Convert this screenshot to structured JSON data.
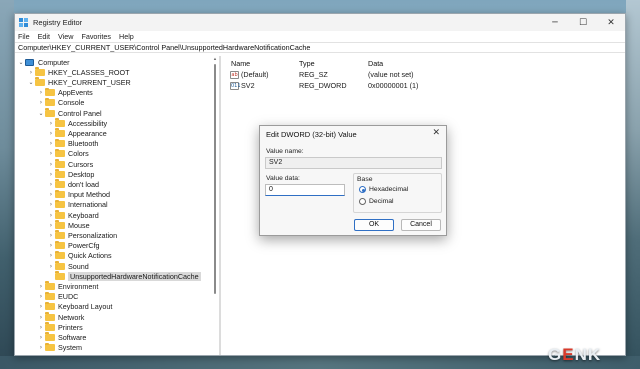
{
  "window": {
    "title": "Registry Editor",
    "controls": [
      "─",
      "☐",
      "✕"
    ]
  },
  "menu": [
    "File",
    "Edit",
    "View",
    "Favorites",
    "Help"
  ],
  "address": "Computer\\HKEY_CURRENT_USER\\Control Panel\\UnsupportedHardwareNotificationCache",
  "tree": {
    "root": "Computer",
    "items": [
      {
        "label": "HKEY_CLASSES_ROOT",
        "depth": 1,
        "expanded": false
      },
      {
        "label": "HKEY_CURRENT_USER",
        "depth": 1,
        "expanded": true
      },
      {
        "label": "AppEvents",
        "depth": 2,
        "expanded": false
      },
      {
        "label": "Console",
        "depth": 2,
        "expanded": false
      },
      {
        "label": "Control Panel",
        "depth": 2,
        "expanded": true
      },
      {
        "label": "Accessibility",
        "depth": 3,
        "expanded": false
      },
      {
        "label": "Appearance",
        "depth": 3,
        "expanded": false
      },
      {
        "label": "Bluetooth",
        "depth": 3,
        "expanded": false
      },
      {
        "label": "Colors",
        "depth": 3,
        "expanded": false
      },
      {
        "label": "Cursors",
        "depth": 3,
        "expanded": false
      },
      {
        "label": "Desktop",
        "depth": 3,
        "expanded": false
      },
      {
        "label": "don't load",
        "depth": 3,
        "expanded": false
      },
      {
        "label": "Input Method",
        "depth": 3,
        "expanded": false
      },
      {
        "label": "International",
        "depth": 3,
        "expanded": false
      },
      {
        "label": "Keyboard",
        "depth": 3,
        "expanded": false
      },
      {
        "label": "Mouse",
        "depth": 3,
        "expanded": false
      },
      {
        "label": "Personalization",
        "depth": 3,
        "expanded": false
      },
      {
        "label": "PowerCfg",
        "depth": 3,
        "expanded": false
      },
      {
        "label": "Quick Actions",
        "depth": 3,
        "expanded": false
      },
      {
        "label": "Sound",
        "depth": 3,
        "expanded": false
      },
      {
        "label": "UnsupportedHardwareNotificationCache",
        "depth": 3,
        "expanded": false,
        "selected": true
      },
      {
        "label": "Environment",
        "depth": 2,
        "expanded": false
      },
      {
        "label": "EUDC",
        "depth": 2,
        "expanded": false
      },
      {
        "label": "Keyboard Layout",
        "depth": 2,
        "expanded": false
      },
      {
        "label": "Network",
        "depth": 2,
        "expanded": false
      },
      {
        "label": "Printers",
        "depth": 2,
        "expanded": false
      },
      {
        "label": "Software",
        "depth": 2,
        "expanded": false
      },
      {
        "label": "System",
        "depth": 2,
        "expanded": false
      }
    ]
  },
  "list": {
    "columns": [
      "Name",
      "Type",
      "Data"
    ],
    "rows": [
      {
        "icon": "ab",
        "name": "(Default)",
        "type": "REG_SZ",
        "data": "(value not set)"
      },
      {
        "icon": "011",
        "name": "SV2",
        "type": "REG_DWORD",
        "data": "0x00000001 (1)"
      }
    ]
  },
  "dialog": {
    "title": "Edit DWORD (32-bit) Value",
    "value_name_label": "Value name:",
    "value_name": "SV2",
    "value_data_label": "Value data:",
    "value_data": "0",
    "base_label": "Base",
    "hex_label": "Hexadecimal",
    "dec_label": "Decimal",
    "base_selected": "Hexadecimal",
    "ok": "OK",
    "cancel": "Cancel"
  },
  "watermark": {
    "logo_a": "G",
    "logo_b": "E",
    "logo_c": "NK"
  }
}
